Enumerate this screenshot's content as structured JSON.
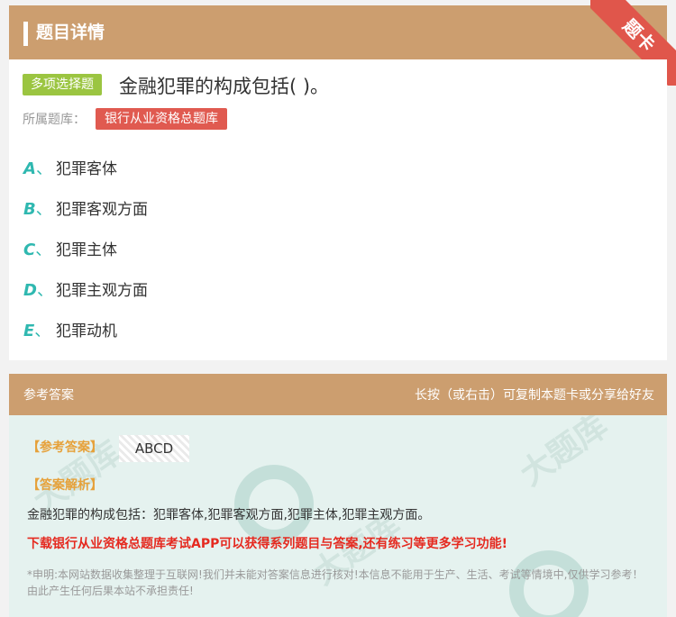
{
  "header": {
    "title": "题目详情",
    "corner_badge": "题卡"
  },
  "question": {
    "type_label": "多项选择题",
    "text": "金融犯罪的构成包括( )。",
    "bank_label": "所属题库：",
    "bank_name": "银行从业资格总题库",
    "options": [
      {
        "letter": "A",
        "text": "犯罪客体"
      },
      {
        "letter": "B",
        "text": "犯罪客观方面"
      },
      {
        "letter": "C",
        "text": "犯罪主体"
      },
      {
        "letter": "D",
        "text": "犯罪主观方面"
      },
      {
        "letter": "E",
        "text": "犯罪动机"
      }
    ]
  },
  "answer_section": {
    "title": "参考答案",
    "hint": "长按（或右击）可复制本题卡或分享给好友",
    "answer_label": "【参考答案】",
    "answer_value": "ABCD",
    "explanation_label": "【答案解析】",
    "explanation": "金融犯罪的构成包括：犯罪客体,犯罪客观方面,犯罪主体,犯罪主观方面。",
    "promo": "下载银行从业资格总题库考试APP可以获得系列题目与答案,还有练习等更多学习功能!",
    "disclaimer": "*申明:本网站数据收集整理于互联网!我们并未能对答案信息进行核对!本信息不能用于生产、生活、考试等情境中,仅供学习参考！由此产生任何后果本站不承担责任!"
  },
  "colors": {
    "header": "#cc9e6f",
    "accent_teal": "#2fb8b0",
    "type_green": "#9bc541",
    "tag_red": "#e05a50"
  }
}
